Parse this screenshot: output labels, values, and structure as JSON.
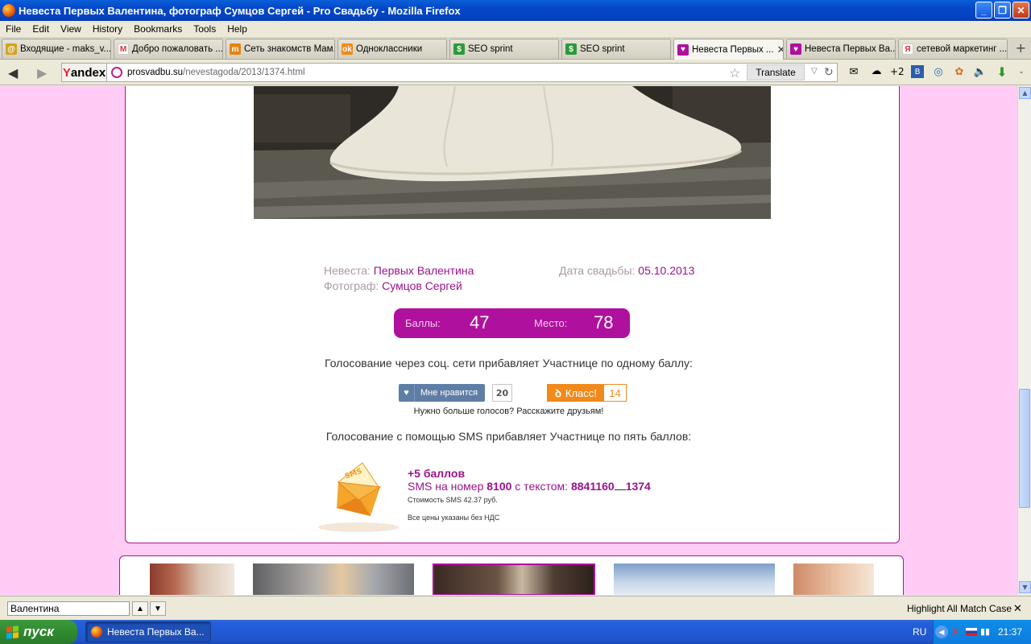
{
  "window": {
    "title": "Невеста Первых Валентина, фотограф Сумцов Сергей - Pro Свадьбу - Mozilla Firefox"
  },
  "menu": [
    "File",
    "Edit",
    "View",
    "History",
    "Bookmarks",
    "Tools",
    "Help"
  ],
  "tabs": [
    {
      "label": "Входящие - maks_v...",
      "icon": "yandex-mail-icon",
      "color": "#d4a21b"
    },
    {
      "label": "Добро пожаловать ...",
      "icon": "gmail-icon",
      "color": "#d33"
    },
    {
      "label": "Сеть знакомств Мам...",
      "icon": "mamba-icon",
      "color": "#e8830f"
    },
    {
      "label": "Одноклассники",
      "icon": "odnoklassniki-icon",
      "color": "#f28a1b"
    },
    {
      "label": "SEO sprint",
      "icon": "seosprint-icon",
      "color": "#2a9a3a"
    },
    {
      "label": "SEO sprint",
      "icon": "seosprint-icon",
      "color": "#2a9a3a"
    },
    {
      "label": "Невеста Первых ...",
      "icon": "heart-icon",
      "color": "#b0109e",
      "active": true
    },
    {
      "label": "Невеста Первых Ва...",
      "icon": "heart-icon",
      "color": "#b0109e"
    },
    {
      "label": "сетевой маркетинг ...",
      "icon": "yandex-icon",
      "color": "#e2252b"
    }
  ],
  "nav": {
    "yandex_prefix": "Y",
    "yandex_rest": "andex",
    "url_host": "prosvadbu.su",
    "url_path": "/nevestagoda/2013/1374.html",
    "translate": "Translate",
    "weather_badge": "+2"
  },
  "page": {
    "bride_label": "Невеста:",
    "bride_name": "Первых Валентина",
    "date_label": "Дата свадьбы:",
    "date_value": "05.10.2013",
    "photographer_label": "Фотограф:",
    "photographer_name": "Сумцов Сергей",
    "score_label": "Баллы:",
    "score_value": "47",
    "place_label": "Место:",
    "place_value": "78",
    "social_vote_text": "Голосование через соц. сети прибавляет Участнице по одному баллу:",
    "vk_like_label": "Мне нравится",
    "vk_like_count": "20",
    "ok_class_label": "Класс!",
    "ok_class_count": "14",
    "more_votes_text": "Нужно больше голосов? Расскажите друзьям!",
    "sms_vote_text": "Голосование с помощью SMS прибавляет Участнице по пять баллов:",
    "sms_icon_text": "SMS",
    "sms_points": "+5 баллов",
    "sms_number_prefix": "SMS на номер",
    "sms_number": "8100",
    "sms_text_prefix": "с текстом:",
    "sms_code_a": "8841160",
    "sms_code_b": "1374",
    "sms_cost": "Стоимость SMS 42.37 руб.",
    "sms_vat": "Все цены указаны без НДС"
  },
  "findbar": {
    "query": "Валентина",
    "highlight_all": "Highlight All",
    "match_case": "Match Case"
  },
  "taskbar": {
    "start": "пуск",
    "window_item": "Невеста Первых Ва...",
    "lang": "RU",
    "clock": "21:37"
  }
}
